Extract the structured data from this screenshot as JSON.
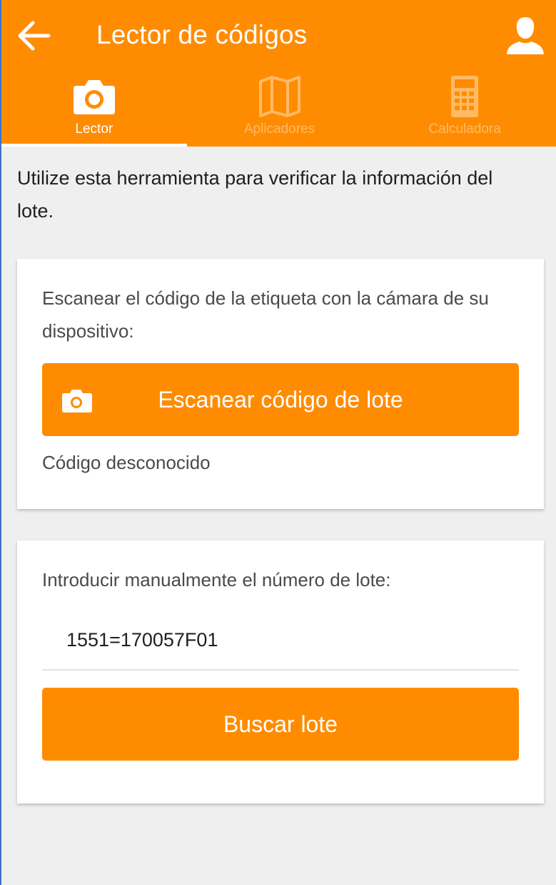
{
  "appbar": {
    "title": "Lector de códigos",
    "back_icon": "arrow-left-icon",
    "profile_icon": "user-icon"
  },
  "tabs": [
    {
      "label": "Lector",
      "icon": "camera-icon",
      "active": true
    },
    {
      "label": "Aplicadores",
      "icon": "map-icon",
      "active": false
    },
    {
      "label": "Calculadora",
      "icon": "calculator-icon",
      "active": false
    }
  ],
  "intro": "Utilize esta herramienta para verificar la información del lote.",
  "scan_card": {
    "instructions": "Escanear el código de la etiqueta con la cámara de su dispositivo:",
    "button_label": "Escanear código de lote",
    "status": "Código desconocido"
  },
  "manual_card": {
    "instructions": "Introducir manualmente el número de lote:",
    "lot_value": "1551=170057F01",
    "lot_placeholder": "",
    "button_label": "Buscar lote"
  },
  "colors": {
    "accent": "#ff8c00",
    "background": "#efefef",
    "card": "#ffffff",
    "text": "#1f1f1f"
  }
}
